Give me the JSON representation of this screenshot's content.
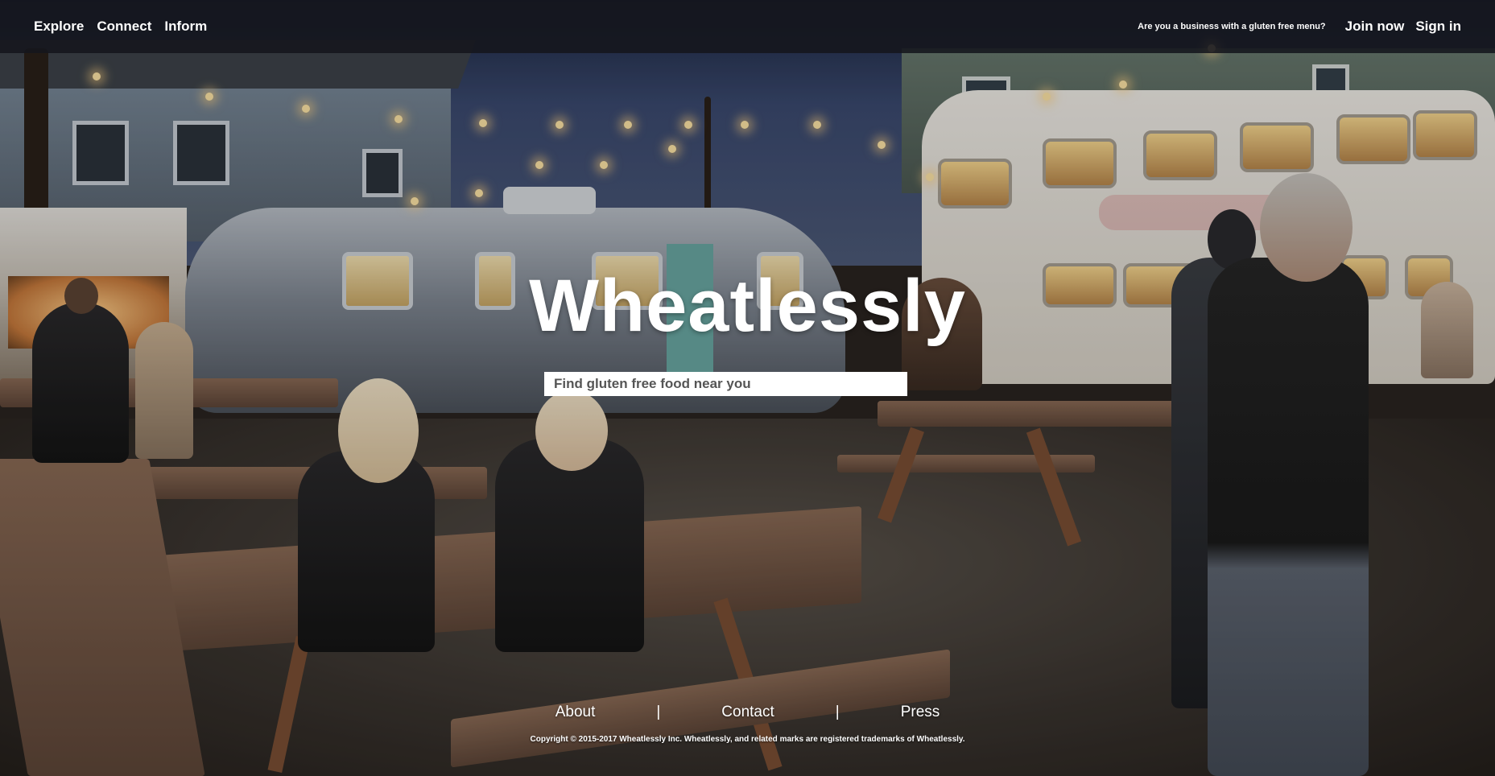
{
  "brand": {
    "title": "Wheatlessly"
  },
  "topbar": {
    "nav": [
      {
        "label": "Explore"
      },
      {
        "label": "Connect"
      },
      {
        "label": "Inform"
      }
    ],
    "business_question": "Are you a business with a gluten free menu?",
    "join_label": "Join now",
    "signin_label": "Sign in"
  },
  "search": {
    "placeholder": "Find gluten free food near you",
    "value": ""
  },
  "footer": {
    "links": [
      {
        "label": "About"
      },
      {
        "label": "Contact"
      },
      {
        "label": "Press"
      }
    ],
    "separator": "|",
    "copyright": "Copyright © 2015-2017 Wheatlessly Inc. Wheatlessly, and related marks are registered trademarks of Wheatlessly."
  },
  "colors": {
    "topbar_bg": "#14161c",
    "text": "#ffffff",
    "search_bg": "#ffffff"
  },
  "background_image": {
    "description_icon": "food-cart-pod-photo"
  }
}
